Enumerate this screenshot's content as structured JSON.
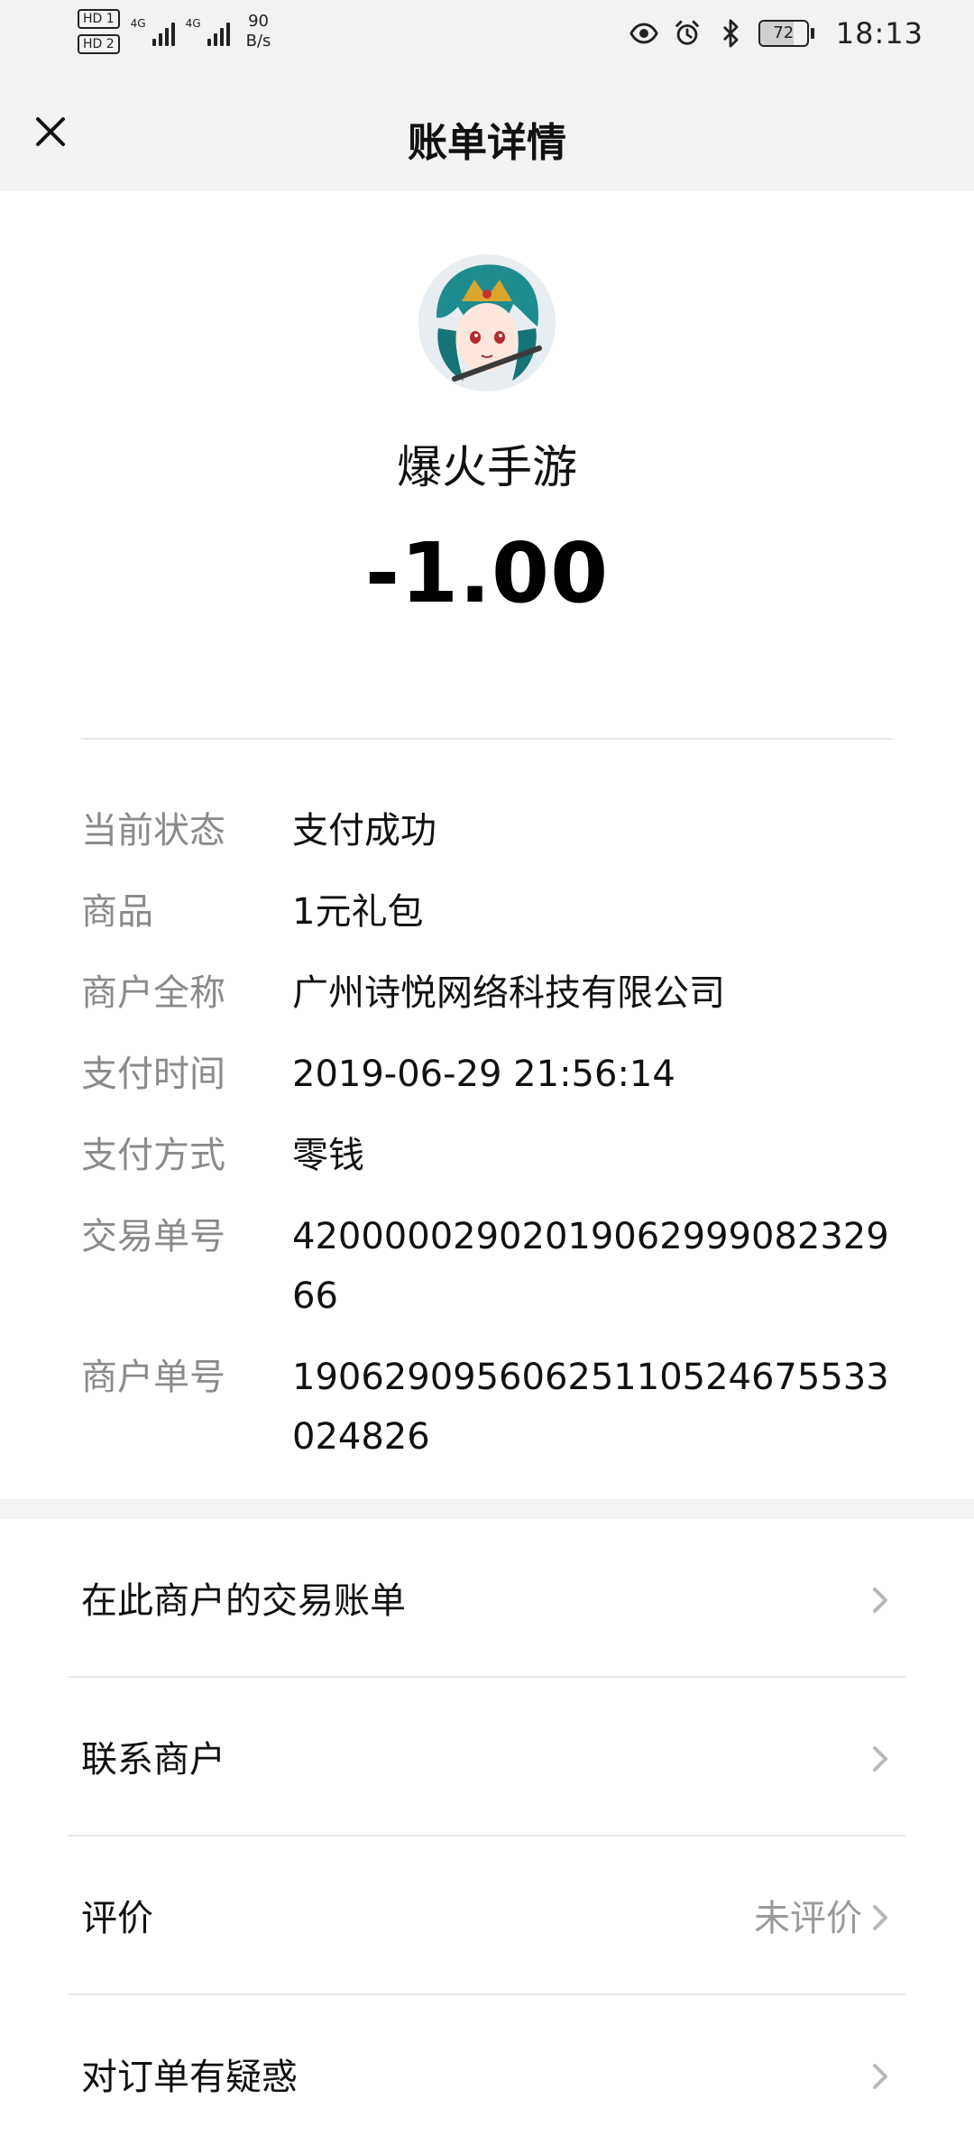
{
  "status_bar": {
    "hd1": "HD 1",
    "hd2": "HD 2",
    "sig1": "4G",
    "sig2": "4G",
    "net_speed_value": "90",
    "net_speed_unit": "B/s",
    "battery_percent": 72,
    "battery_label": "72",
    "time": "18:13",
    "icons": [
      "eye-icon",
      "alarm-icon",
      "bluetooth-icon",
      "battery-icon"
    ]
  },
  "header": {
    "title": "账单详情",
    "close_icon": "close-icon"
  },
  "merchant": {
    "name": "爆火手游",
    "amount": "-1.00"
  },
  "details": {
    "rows": [
      {
        "label": "当前状态",
        "value": "支付成功"
      },
      {
        "label": "商品",
        "value": "1元礼包"
      },
      {
        "label": "商户全称",
        "value": "广州诗悦网络科技有限公司"
      },
      {
        "label": "支付时间",
        "value": "2019-06-29 21:56:14"
      },
      {
        "label": "支付方式",
        "value": "零钱"
      },
      {
        "label": "交易单号",
        "value": "4200000290201906299908232966"
      },
      {
        "label": "商户单号",
        "value": "19062909560625110524675533024826"
      }
    ]
  },
  "actions": [
    {
      "label": "在此商户的交易账单",
      "status": ""
    },
    {
      "label": "联系商户",
      "status": ""
    },
    {
      "label": "评价",
      "status": "未评价"
    },
    {
      "label": "对订单有疑惑",
      "status": ""
    }
  ]
}
